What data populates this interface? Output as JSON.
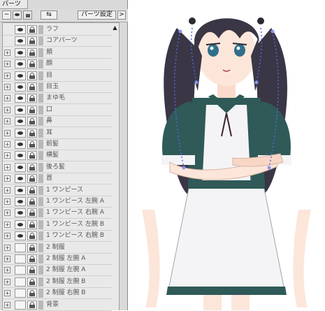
{
  "panel": {
    "title": "パーツ",
    "toolbar": {
      "collapse": "−",
      "swap": "⇆",
      "parts_settings": "パーツ設定",
      "more": ">"
    },
    "scroll_up": "▲",
    "rows": [
      {
        "label": "ラフ",
        "expand": "",
        "visible": true
      },
      {
        "label": "コアパーツ",
        "expand": "",
        "visible": true
      },
      {
        "label": "頬",
        "expand": "+",
        "visible": true
      },
      {
        "label": "顔",
        "expand": "+",
        "visible": true
      },
      {
        "label": "目",
        "expand": "+",
        "visible": true
      },
      {
        "label": "目玉",
        "expand": "+",
        "visible": true
      },
      {
        "label": "まゆ毛",
        "expand": "+",
        "visible": true
      },
      {
        "label": "口",
        "expand": "+",
        "visible": true
      },
      {
        "label": "鼻",
        "expand": "+",
        "visible": true
      },
      {
        "label": "耳",
        "expand": "+",
        "visible": true
      },
      {
        "label": "前髪",
        "expand": "+",
        "visible": true
      },
      {
        "label": "横髪",
        "expand": "+",
        "visible": true
      },
      {
        "label": "後ろ髪",
        "expand": "+",
        "visible": true
      },
      {
        "label": "首",
        "expand": "+",
        "visible": true
      },
      {
        "label": "1 ワンピース",
        "expand": "+",
        "visible": true
      },
      {
        "label": "1 ワンピース 左腕 A",
        "expand": "+",
        "visible": true
      },
      {
        "label": "1 ワンピース 右腕 A",
        "expand": "+",
        "visible": true
      },
      {
        "label": "1 ワンピース 左腕 B",
        "expand": "+",
        "visible": true
      },
      {
        "label": "1 ワンピース 右腕 B",
        "expand": "+",
        "visible": true
      },
      {
        "label": "2 制服",
        "expand": "+",
        "visible": false
      },
      {
        "label": "2 制服 左腕 A",
        "expand": "+",
        "visible": false
      },
      {
        "label": "2 制服 左腕 A",
        "expand": "+",
        "visible": false
      },
      {
        "label": "2 制服 左腕 B",
        "expand": "+",
        "visible": false
      },
      {
        "label": "2 制服 右腕 B",
        "expand": "+",
        "visible": false
      },
      {
        "label": "背景",
        "expand": "+",
        "visible": false
      }
    ]
  },
  "colors": {
    "hair": "#3a3645",
    "dress_dark": "#2f5a58",
    "dress_white": "#f4f4f6",
    "skin": "#fce6da",
    "mesh": "#5566dd"
  }
}
